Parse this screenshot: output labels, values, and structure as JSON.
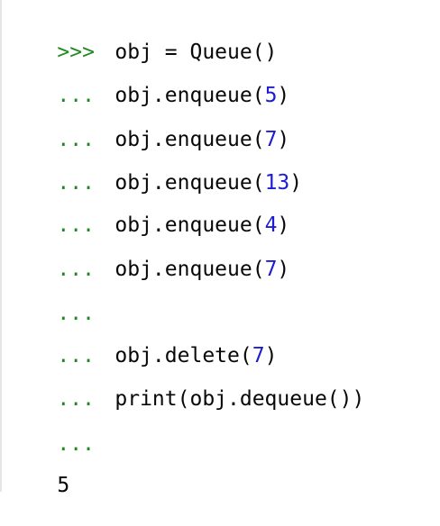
{
  "console": {
    "lines": [
      {
        "prompt": ">>>",
        "parts": [
          {
            "t": "obj = Queue()",
            "k": "code"
          }
        ]
      },
      {
        "prompt": "...",
        "parts": [
          {
            "t": "obj.enqueue(",
            "k": "code"
          },
          {
            "t": "5",
            "k": "num"
          },
          {
            "t": ")",
            "k": "code"
          }
        ]
      },
      {
        "prompt": "...",
        "parts": [
          {
            "t": "obj.enqueue(",
            "k": "code"
          },
          {
            "t": "7",
            "k": "num"
          },
          {
            "t": ")",
            "k": "code"
          }
        ]
      },
      {
        "prompt": "...",
        "parts": [
          {
            "t": "obj.enqueue(",
            "k": "code"
          },
          {
            "t": "13",
            "k": "num"
          },
          {
            "t": ")",
            "k": "code"
          }
        ]
      },
      {
        "prompt": "...",
        "parts": [
          {
            "t": "obj.enqueue(",
            "k": "code"
          },
          {
            "t": "4",
            "k": "num"
          },
          {
            "t": ")",
            "k": "code"
          }
        ]
      },
      {
        "prompt": "...",
        "parts": [
          {
            "t": "obj.enqueue(",
            "k": "code"
          },
          {
            "t": "7",
            "k": "num"
          },
          {
            "t": ")",
            "k": "code"
          }
        ]
      },
      {
        "prompt": "...",
        "parts": []
      },
      {
        "prompt": "...",
        "parts": [
          {
            "t": "obj.delete(",
            "k": "code"
          },
          {
            "t": "7",
            "k": "num"
          },
          {
            "t": ")",
            "k": "code"
          }
        ]
      },
      {
        "prompt": "...",
        "parts": [
          {
            "t": "print(obj.dequeue())",
            "k": "code"
          }
        ]
      },
      {
        "prompt": "...",
        "parts": []
      },
      {
        "prompt": "",
        "parts": [
          {
            "t": "5",
            "k": "output"
          }
        ]
      }
    ]
  },
  "colors": {
    "prompt": "#1f8a1f",
    "number": "#1c1cd4",
    "text": "#080808",
    "background": "#ffffff"
  }
}
